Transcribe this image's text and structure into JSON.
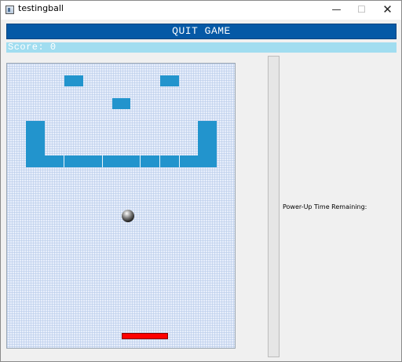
{
  "window": {
    "title": "testingball",
    "minimize_glyph": "—",
    "maximize_glyph": "☐",
    "close_glyph": "✕"
  },
  "header": {
    "quit_label": "QUIT GAME",
    "score_text": "Score: 0"
  },
  "sidebar": {
    "powerup_label": "Power-Up Time Remaining:",
    "powerup_remaining_fraction": 0
  },
  "colors": {
    "quit_button": "#0559a6",
    "score_bar": "#a1ddf0",
    "brick": "#2294cd",
    "paddle": "#ff0000",
    "playfield": "#e7eefb"
  },
  "game": {
    "brick_count": 13,
    "ball_color": "#222222"
  }
}
